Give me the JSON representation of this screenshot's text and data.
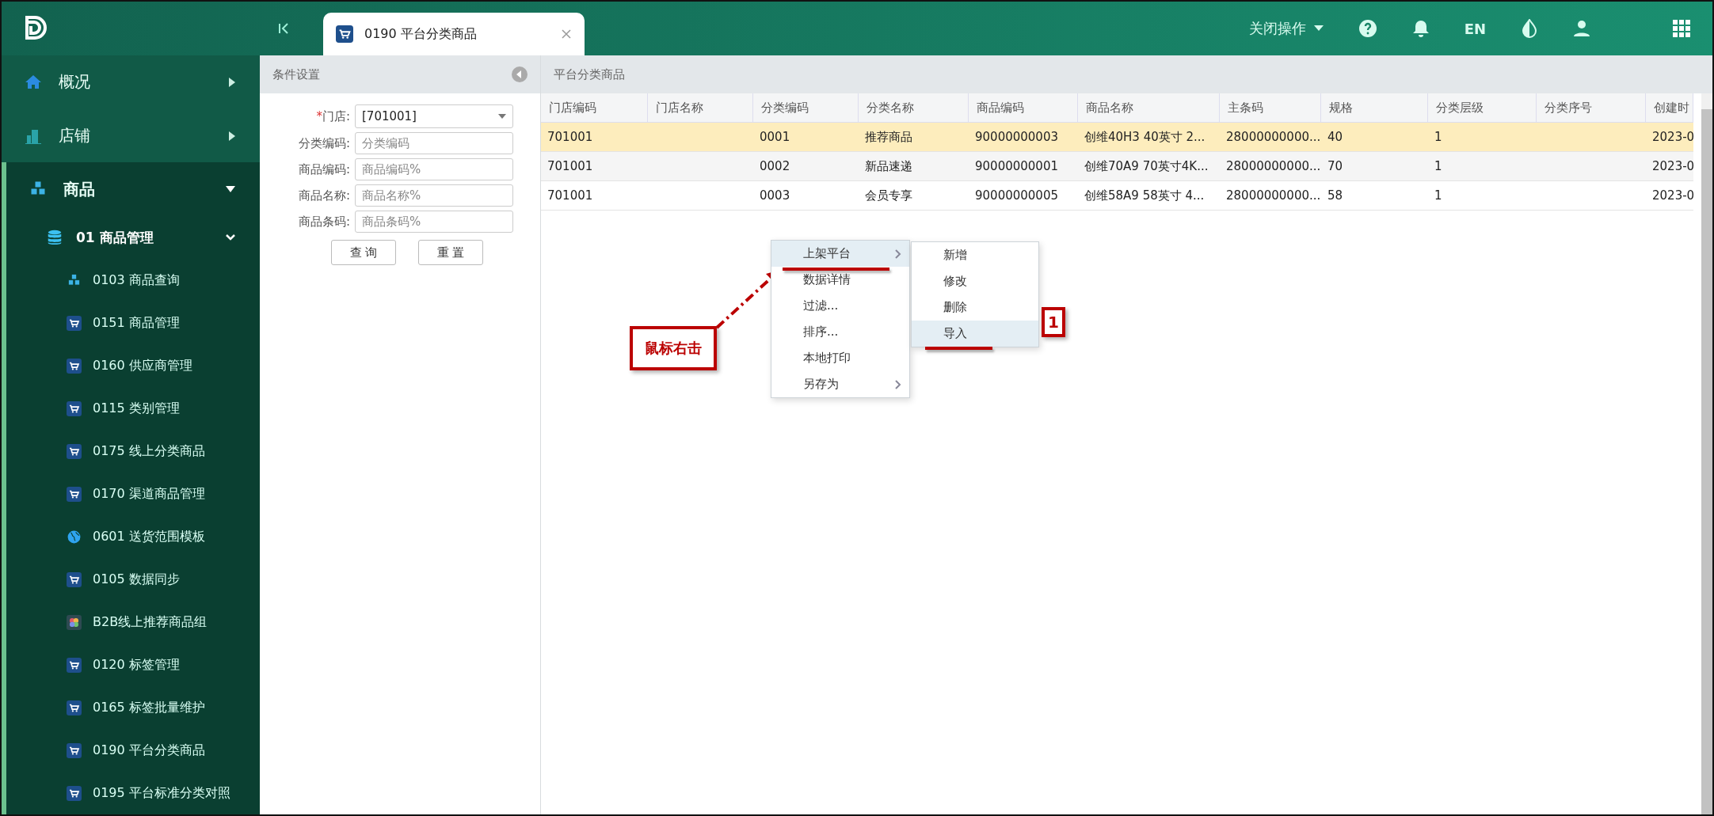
{
  "header": {
    "tabs": [
      {
        "label": "0190 平台分类商品",
        "selected": true
      }
    ],
    "close_menu": "关闭操作",
    "language": "EN"
  },
  "sidebar": {
    "items": [
      {
        "label": "概况",
        "kind": "home",
        "expanded": false
      },
      {
        "label": "店铺",
        "kind": "building",
        "expanded": false
      },
      {
        "label": "商品",
        "kind": "cubes",
        "expanded": true,
        "children": [
          {
            "label": "01 商品管理",
            "kind": "database",
            "expanded": true,
            "children": [
              {
                "label": "0103 商品查询",
                "kind": "cubes"
              },
              {
                "label": "0151 商品管理",
                "kind": "cart"
              },
              {
                "label": "0160 供应商管理",
                "kind": "cart"
              },
              {
                "label": "0115 类别管理",
                "kind": "cart"
              },
              {
                "label": "0175 线上分类商品",
                "kind": "cart"
              },
              {
                "label": "0170 渠道商品管理",
                "kind": "cart"
              },
              {
                "label": "0601 送货范围模板",
                "kind": "globe"
              },
              {
                "label": "0105 数据同步",
                "kind": "cart"
              },
              {
                "label": "B2B线上推荐商品组",
                "kind": "pinwheel"
              },
              {
                "label": "0120 标签管理",
                "kind": "cart"
              },
              {
                "label": "0165 标签批量维护",
                "kind": "cart"
              },
              {
                "label": "0190 平台分类商品",
                "kind": "cart"
              },
              {
                "label": "0195 平台标准分类对照",
                "kind": "cart"
              }
            ]
          }
        ]
      }
    ]
  },
  "filter": {
    "title": "条件设置",
    "fields": [
      {
        "label": "门店:",
        "required_mark": "*",
        "kind": "select",
        "value": "[701001]"
      },
      {
        "label": "分类编码:",
        "kind": "text",
        "placeholder": "分类编码"
      },
      {
        "label": "商品编码:",
        "kind": "text",
        "placeholder": "商品编码%"
      },
      {
        "label": "商品名称:",
        "kind": "text",
        "placeholder": "商品名称%"
      },
      {
        "label": "商品条码:",
        "kind": "text",
        "placeholder": "商品条码%"
      }
    ],
    "buttons": [
      "查 询",
      "重 置"
    ]
  },
  "table": {
    "title": "平台分类商品",
    "columns": [
      "门店编码",
      "门店名称",
      "分类编码",
      "分类名称",
      "商品编码",
      "商品名称",
      "主条码",
      "规格",
      "分类层级",
      "分类序号",
      "创建时"
    ],
    "rows": [
      {
        "selected": true,
        "cells": [
          "701001",
          "",
          "0001",
          "推荐商品",
          "90000000003",
          "创维40H3 40英寸 2...",
          "28000000000...",
          "40",
          "1",
          "",
          "2023-0"
        ]
      },
      {
        "selected": false,
        "cells": [
          "701001",
          "",
          "0002",
          "新品速递",
          "90000000001",
          "创维70A9 70英寸4K...",
          "28000000000...",
          "70",
          "1",
          "",
          "2023-0"
        ]
      },
      {
        "selected": false,
        "cells": [
          "701001",
          "",
          "0003",
          "会员专享",
          "90000000005",
          "创维58A9 58英寸 4...",
          "28000000000...",
          "58",
          "1",
          "",
          "2023-0"
        ]
      }
    ]
  },
  "context_menu": {
    "items": [
      {
        "label": "上架平台",
        "submenu": true,
        "selected": true
      },
      {
        "label": "数据详情",
        "submenu": false,
        "selected": false
      },
      {
        "label": "过滤...",
        "submenu": false,
        "selected": false
      },
      {
        "label": "排序...",
        "submenu": false,
        "selected": false
      },
      {
        "label": "本地打印",
        "submenu": false,
        "selected": false
      },
      {
        "label": "另存为",
        "submenu": true,
        "selected": false
      }
    ],
    "submenu": [
      {
        "label": "新增",
        "selected": false
      },
      {
        "label": "修改",
        "selected": false
      },
      {
        "label": "删除",
        "selected": false
      },
      {
        "label": "导入",
        "selected": true
      }
    ]
  },
  "annotations": {
    "callout": "鼠标右击",
    "step": "1"
  }
}
